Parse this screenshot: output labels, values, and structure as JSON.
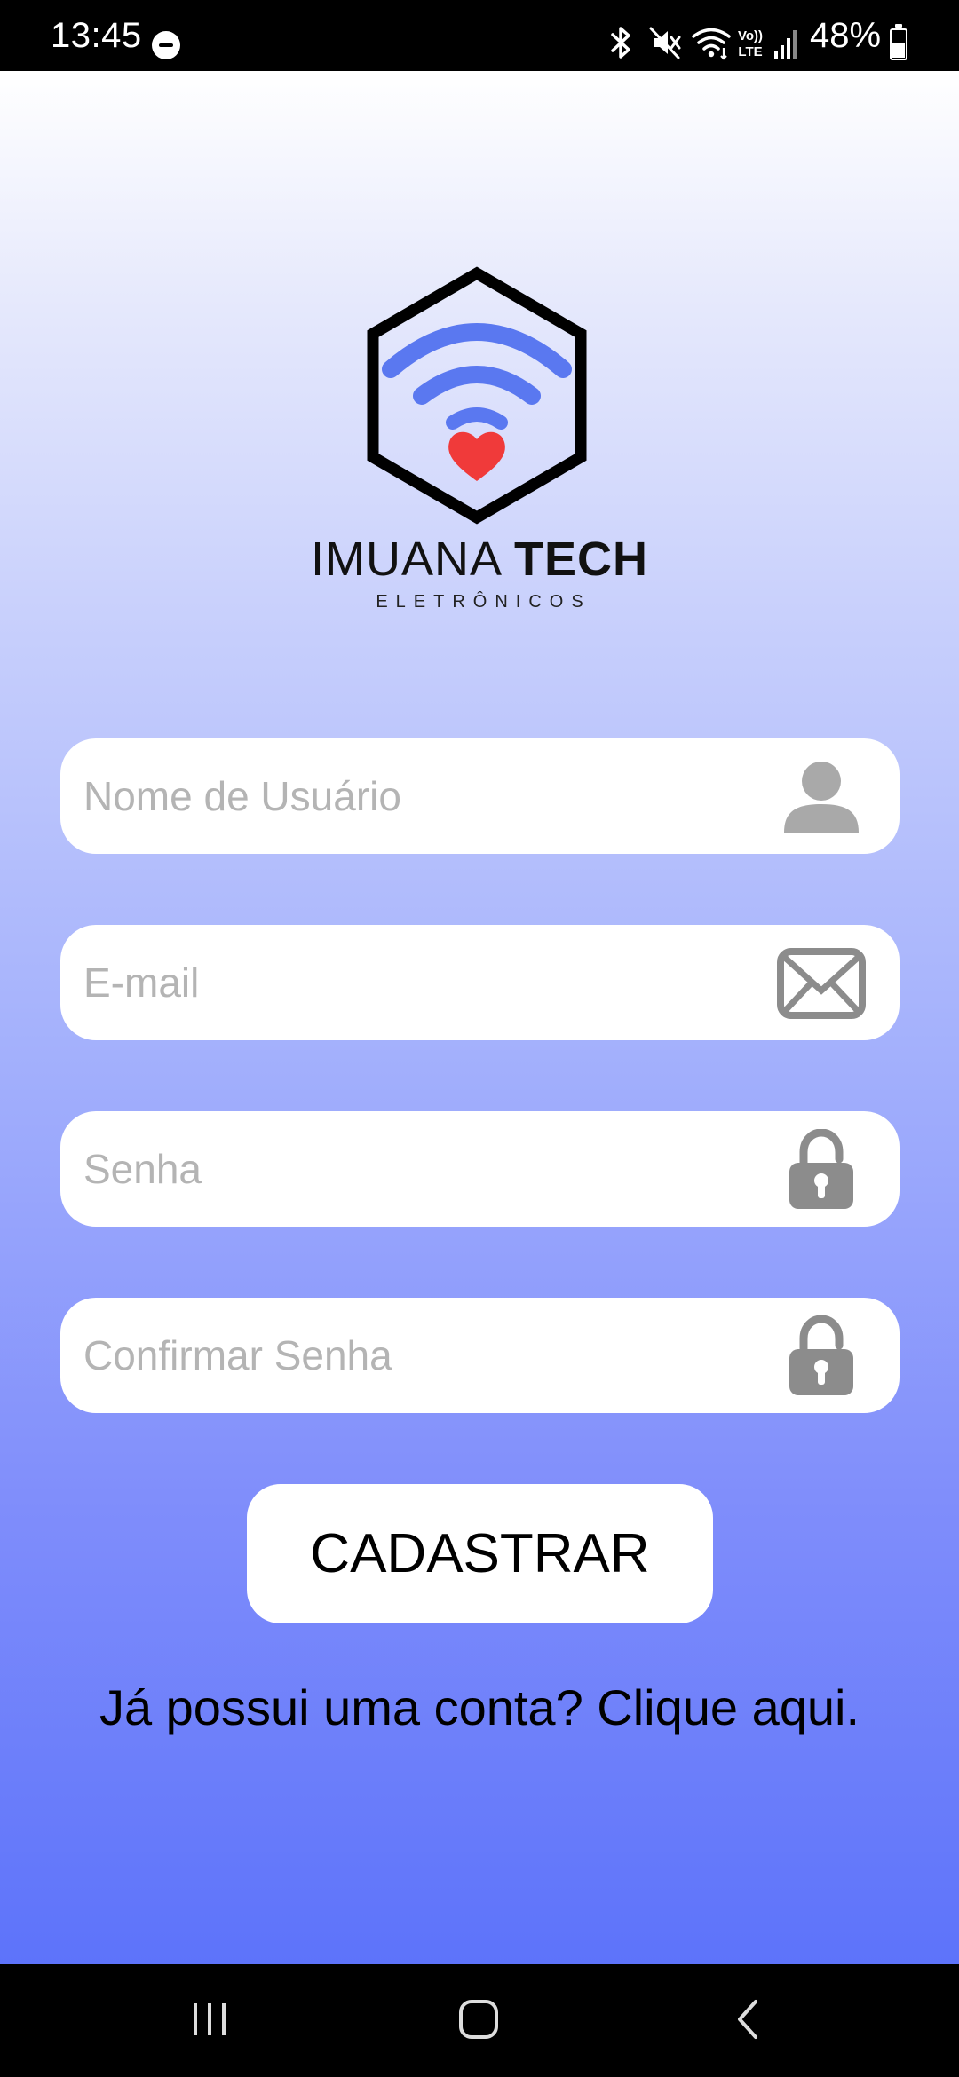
{
  "status_bar": {
    "time": "13:45",
    "battery": "48%",
    "icons": [
      "dnd-icon",
      "bluetooth-icon",
      "mute-icon",
      "wifi-icon",
      "volte-icon",
      "signal-icon",
      "battery-icon"
    ]
  },
  "brand": {
    "name_light": "IMUANA",
    "name_bold": "TECH",
    "subtitle": "ELETRÔNICOS",
    "colors": {
      "wifi": "#5a78f0",
      "heart": "#f03a3a",
      "hexagon": "#000000"
    }
  },
  "form": {
    "username": {
      "placeholder": "Nome de Usuário",
      "value": "",
      "icon": "user-icon"
    },
    "email": {
      "placeholder": "E-mail",
      "value": "",
      "icon": "envelope-icon"
    },
    "password": {
      "placeholder": "Senha",
      "value": "",
      "icon": "lock-icon"
    },
    "confirm_password": {
      "placeholder": "Confirmar Senha",
      "value": "",
      "icon": "lock-icon"
    },
    "submit_label": "CADASTRAR",
    "login_prompt": "Já possui uma conta? Clique aqui."
  },
  "nav": {
    "buttons": [
      "recent-apps-icon",
      "home-icon",
      "back-icon"
    ]
  }
}
